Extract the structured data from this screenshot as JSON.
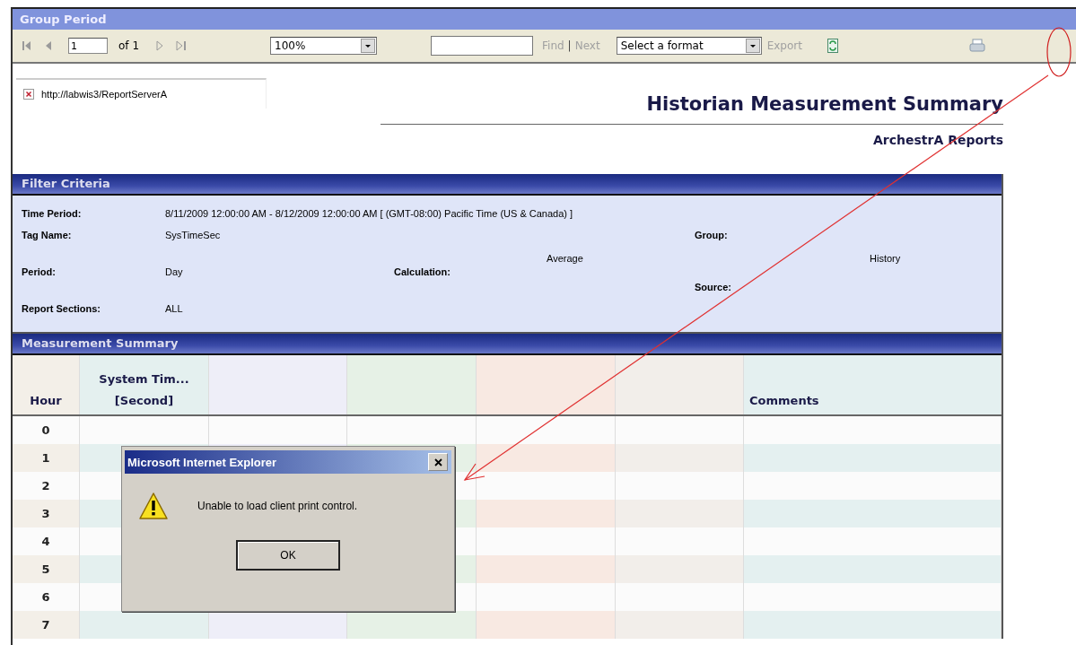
{
  "window": {
    "title": "Group Period"
  },
  "toolbar": {
    "page_input": "1",
    "page_count": "of 1",
    "zoom": "100%",
    "find": "Find",
    "separator": "|",
    "next": "Next",
    "format_select": "Select a format",
    "export": "Export"
  },
  "report": {
    "broken_image_url": "http://labwis3/ReportServerA",
    "title": "Historian Measurement Summary",
    "subtitle": "ArchestrA Reports"
  },
  "filter_criteria": {
    "heading": "Filter Criteria",
    "time_period": {
      "label": "Time Period:",
      "value": "8/11/2009 12:00:00 AM - 8/12/2009 12:00:00 AM [ (GMT-08:00) Pacific Time (US & Canada) ]"
    },
    "tag_name": {
      "label": "Tag Name:",
      "value": "SysTimeSec"
    },
    "group": {
      "label": "Group:"
    },
    "period": {
      "label": "Period:",
      "value": "Day"
    },
    "calculation": {
      "label": "Calculation:",
      "value": "Average"
    },
    "source": {
      "label": "Source:",
      "value": "History"
    },
    "report_sections": {
      "label": "Report Sections:",
      "value": "ALL"
    }
  },
  "measurement_summary": {
    "heading": "Measurement Summary",
    "columns": [
      {
        "label": "Hour",
        "color": "#f3efe8"
      },
      {
        "label": "System Tim...",
        "unit": "[Second]",
        "color": "#e4f0ef"
      },
      {
        "color": "#eeeef8"
      },
      {
        "color": "#e6f1e6"
      },
      {
        "color": "#f8e9e2"
      },
      {
        "color": "#f2eeea"
      },
      {
        "label": "Comments",
        "color": "#e4f0f0"
      }
    ],
    "rows": [
      "0",
      "1",
      "2",
      "3",
      "4",
      "5",
      "6",
      "7"
    ]
  },
  "dialog": {
    "title": "Microsoft Internet Explorer",
    "message": "Unable to load client print control.",
    "button": "OK"
  }
}
